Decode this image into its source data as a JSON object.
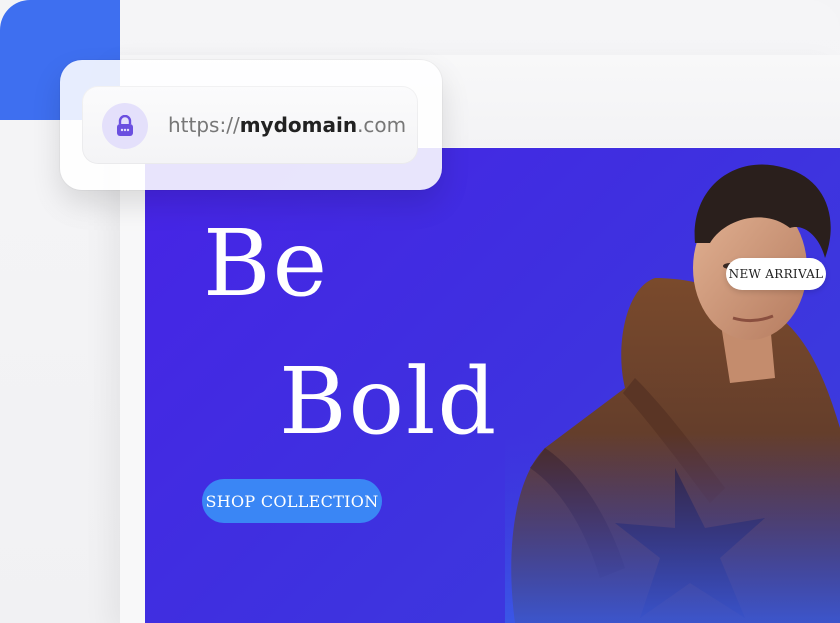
{
  "address_bar": {
    "scheme": "https://",
    "domain": "mydomain",
    "tld": ".com"
  },
  "hero": {
    "title_line1": "Be",
    "title_line2": "Bold",
    "cta_label": "SHOP COLLECTION",
    "badge_label": "NEW ARRIVAL"
  },
  "colors": {
    "accent_blue": "#3e6ff0",
    "hero_purple": "#4724e6",
    "cta_blue": "#3a86f5",
    "lock_tint": "#6b4fe0"
  },
  "icons": {
    "lock": "lock-icon"
  }
}
